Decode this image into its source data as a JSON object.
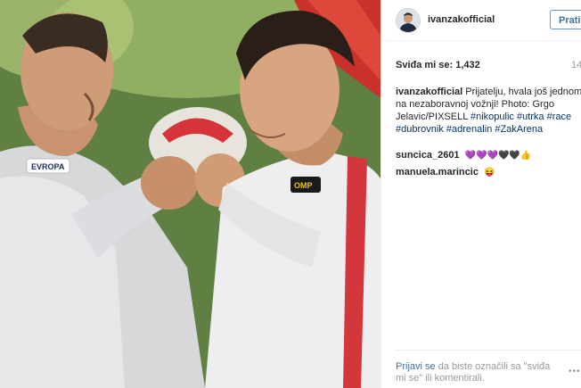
{
  "post": {
    "username": "ivanzakofficial",
    "follow_label": "Prati",
    "likes": "Sviđa mi se: 1,432",
    "time": "14",
    "caption": {
      "author": "ivanzakofficial",
      "text": "Prijatelju, hvala još jednom na nezaboravnoj vožnji! Photo: Grgo Jelavic/PIXSELL",
      "tags": [
        "#nikopulic",
        "#utrka",
        "#race",
        "#dubrovnik",
        "#adrenalin",
        "#ZakArena"
      ]
    },
    "comments": [
      {
        "user": "suncica_2601",
        "text": "💜💜💜🖤🖤👍"
      },
      {
        "user": "manuela.marincic",
        "text": "😝"
      }
    ],
    "login_link": "Prijavi se",
    "login_text": "da biste označili sa \"sviđa mi se\" ili komentirali.",
    "more": "•••"
  },
  "photo": {
    "description_visible": false,
    "suit_text_left": "EVROPA",
    "suit_text_right": "OMP"
  }
}
